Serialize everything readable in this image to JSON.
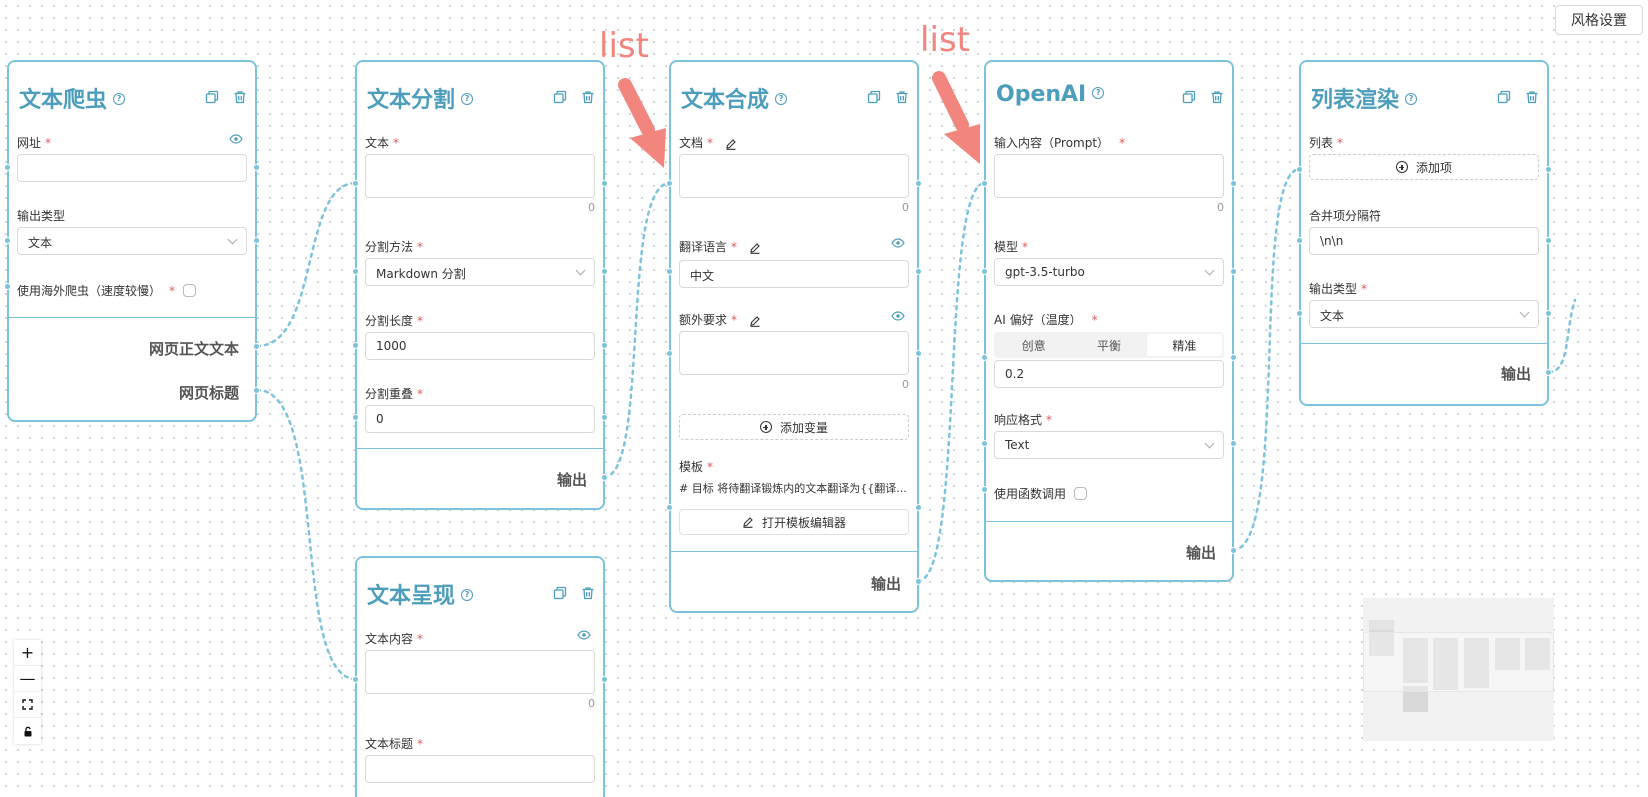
{
  "toolbar": {
    "style_settings": "风格设置"
  },
  "annotations": {
    "label_1": "list",
    "label_2": "list",
    "color": "#f2867e"
  },
  "theme": {
    "accent": "#7cc3dc",
    "title_color": "#4c9ebc",
    "required": "#e05a5a"
  },
  "nodes": {
    "crawler": {
      "title": "文本爬虫",
      "url_label": "网址",
      "output_type_label": "输出类型",
      "output_type_value": "文本",
      "overseas_label": "使用海外爬虫（速度较慢）",
      "output_body": "网页正文文本",
      "output_title": "网页标题"
    },
    "split": {
      "title": "文本分割",
      "text_label": "文本",
      "text_count": "0",
      "method_label": "分割方法",
      "method_value": "Markdown 分割",
      "length_label": "分割长度",
      "length_value": "1000",
      "overlap_label": "分割重叠",
      "overlap_value": "0",
      "output": "输出"
    },
    "present": {
      "title": "文本呈现",
      "content_label": "文本内容",
      "content_count": "0",
      "title_label": "文本标题"
    },
    "synth": {
      "title": "文本合成",
      "doc_label": "文档",
      "doc_count": "0",
      "lang_label": "翻译语言",
      "lang_value": "中文",
      "extra_label": "额外要求",
      "extra_count": "0",
      "add_var": "添加变量",
      "template_label": "模板",
      "template_value": "# 目标 将待翻译锻炼内的文本翻译为{{翻译...",
      "open_editor": "打开模板编辑器",
      "output": "输出"
    },
    "openai": {
      "title": "OpenAI",
      "prompt_label": "输入内容（Prompt）",
      "prompt_count": "0",
      "model_label": "模型",
      "model_value": "gpt-3.5-turbo",
      "temp_label": "AI 偏好（温度）",
      "temp_options": [
        "创意",
        "平衡",
        "精准"
      ],
      "temp_selected": "精准",
      "temp_value": "0.2",
      "format_label": "响应格式",
      "format_value": "Text",
      "function_label": "使用函数调用",
      "output": "输出"
    },
    "list_render": {
      "title": "列表渲染",
      "list_label": "列表",
      "add_item": "添加项",
      "separator_label": "合并项分隔符",
      "separator_value": "\\n\\n",
      "output_type_label": "输出类型",
      "output_type_value": "文本",
      "output": "输出"
    }
  },
  "controls": {
    "zoom_in": "+",
    "zoom_out": "—"
  }
}
